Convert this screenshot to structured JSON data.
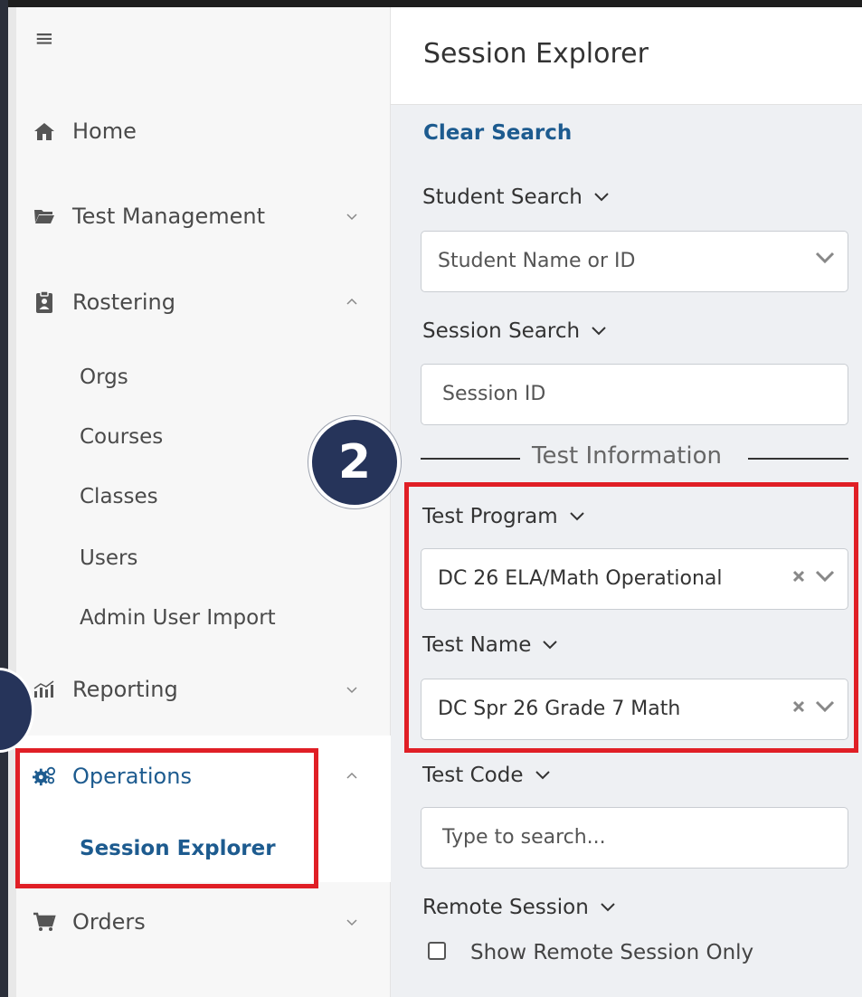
{
  "sidebar": {
    "items": [
      {
        "label": "Home",
        "icon": "home-icon"
      },
      {
        "label": "Test Management",
        "icon": "folder-icon"
      },
      {
        "label": "Rostering",
        "icon": "clipboard-icon"
      },
      {
        "label": "Reporting",
        "icon": "bar-chart-icon"
      },
      {
        "label": "Operations",
        "icon": "gears-icon"
      },
      {
        "label": "Orders",
        "icon": "cart-icon"
      }
    ],
    "rostering_sub": [
      "Orgs",
      "Courses",
      "Classes",
      "Users",
      "Admin User Import"
    ],
    "operations_sub": [
      "Session Explorer"
    ]
  },
  "header": {
    "title": "Session Explorer"
  },
  "main": {
    "clear_search": "Clear Search",
    "student_search": {
      "label": "Student Search",
      "placeholder": "Student Name or ID"
    },
    "session_search": {
      "label": "Session Search",
      "placeholder": "Session ID"
    },
    "test_information": "Test Information",
    "test_program": {
      "label": "Test Program",
      "value": "DC 26 ELA/Math Operational"
    },
    "test_name": {
      "label": "Test Name",
      "value": "DC Spr 26 Grade 7 Math"
    },
    "test_code": {
      "label": "Test Code",
      "placeholder": "Type to search..."
    },
    "remote_session": {
      "label": "Remote Session",
      "checkbox_label": "Show Remote Session Only"
    }
  },
  "annotation": {
    "step_number": "2"
  },
  "colors": {
    "accent": "#1d5b8f",
    "highlight": "#e01f26",
    "badge": "#26345a"
  }
}
